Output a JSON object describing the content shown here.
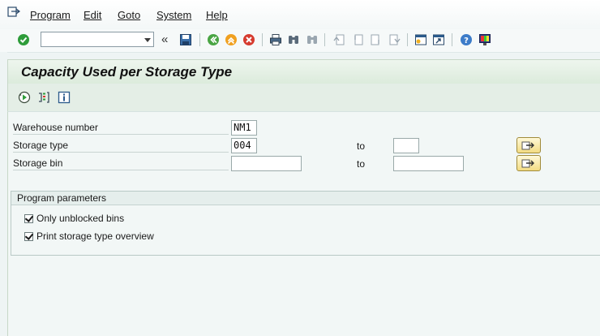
{
  "menu": {
    "items": [
      {
        "label": "Program"
      },
      {
        "label": "Edit"
      },
      {
        "label": "Goto"
      },
      {
        "label": "System"
      },
      {
        "label": "Help"
      }
    ]
  },
  "toolbar": {
    "command_field_value": "",
    "icons": [
      "enter-icon",
      "save-icon",
      "back-icon",
      "exit-icon",
      "cancel-icon",
      "print-icon",
      "find-icon",
      "find-next-icon",
      "first-page-icon",
      "previous-page-icon",
      "next-page-icon",
      "last-page-icon",
      "create-session-icon",
      "shortcut-icon",
      "help-icon",
      "customize-layout-icon"
    ]
  },
  "title": "Capacity Used per Storage Type",
  "selection": {
    "warehouse_number": {
      "label": "Warehouse number",
      "value": "NM1"
    },
    "storage_type": {
      "label": "Storage type",
      "value": "004",
      "to_label": "to",
      "to_value": ""
    },
    "storage_bin": {
      "label": "Storage bin",
      "value": "",
      "to_label": "to",
      "to_value": ""
    }
  },
  "program_parameters": {
    "title": "Program parameters",
    "options": [
      {
        "label": "Only unblocked bins",
        "checked": true
      },
      {
        "label": "Print storage type overview",
        "checked": true
      }
    ]
  },
  "colors": {
    "accent_green": "#2e9c3a",
    "title_bg": "#dcebdc",
    "multi_button": "#f3dc83"
  }
}
